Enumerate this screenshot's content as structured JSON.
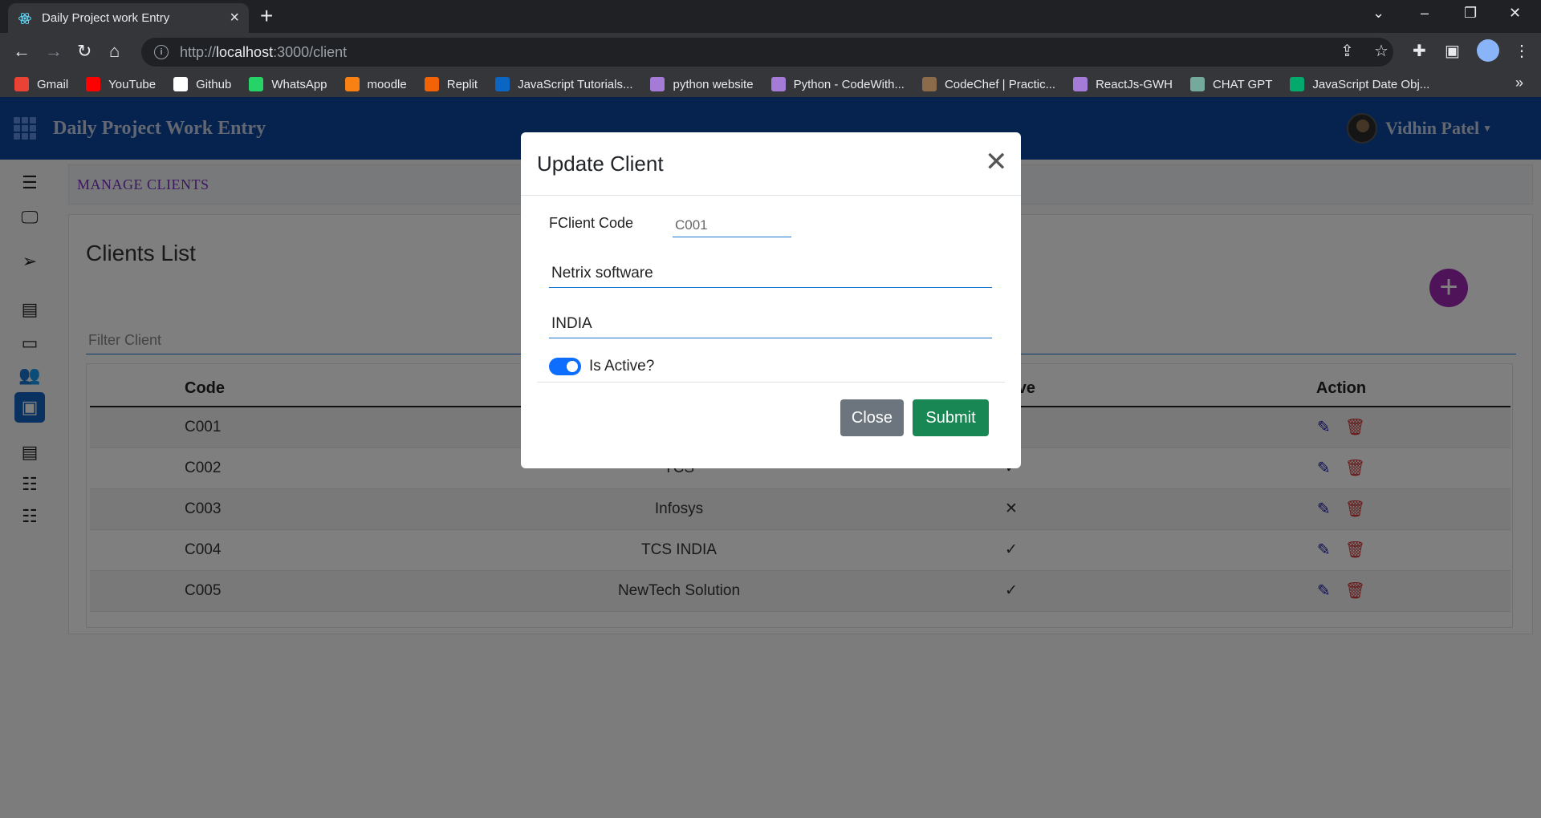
{
  "browser": {
    "tab_title": "Daily Project work Entry",
    "url_prefix": "http://",
    "url_host": "localhost",
    "url_path": ":3000/client",
    "bookmarks": [
      {
        "label": "Gmail",
        "icon": "gmail-icon",
        "color": "#ea4335"
      },
      {
        "label": "YouTube",
        "icon": "youtube-icon",
        "color": "#ff0000"
      },
      {
        "label": "Github",
        "icon": "github-icon",
        "color": "#ffffff"
      },
      {
        "label": "WhatsApp",
        "icon": "whatsapp-icon",
        "color": "#25d366"
      },
      {
        "label": "moodle",
        "icon": "moodle-icon",
        "color": "#f98012"
      },
      {
        "label": "Replit",
        "icon": "replit-icon",
        "color": "#f26207"
      },
      {
        "label": "JavaScript Tutorials...",
        "icon": "linkedin-icon",
        "color": "#0a66c2"
      },
      {
        "label": "python website",
        "icon": "codewithharry-icon",
        "color": "#a47bd6"
      },
      {
        "label": "Python - CodeWith...",
        "icon": "codewithharry-icon",
        "color": "#a47bd6"
      },
      {
        "label": "CodeChef | Practic...",
        "icon": "codechef-icon",
        "color": "#8b6b4a"
      },
      {
        "label": "ReactJs-GWH",
        "icon": "codewithharry-icon",
        "color": "#a47bd6"
      },
      {
        "label": "CHAT GPT",
        "icon": "chatgpt-icon",
        "color": "#74aa9c"
      },
      {
        "label": "JavaScript Date Obj...",
        "icon": "w3schools-icon",
        "color": "#04aa6d"
      }
    ]
  },
  "app": {
    "title": "Daily Project Work Entry",
    "user_name": "Vidhin Patel",
    "breadcrumb": "MANAGE CLIENTS",
    "card_title": "Clients List",
    "filter_placeholder": "Filter Client",
    "table": {
      "headers": {
        "code": "Code",
        "active": "Active",
        "action": "Action"
      },
      "rows": [
        {
          "code": "C001",
          "name": "",
          "active": "✓"
        },
        {
          "code": "C002",
          "name": "TCS",
          "active": "✓"
        },
        {
          "code": "C003",
          "name": "Infosys",
          "active": "✕"
        },
        {
          "code": "C004",
          "name": "TCS INDIA",
          "active": "✓"
        },
        {
          "code": "C005",
          "name": "NewTech Solution",
          "active": "✓"
        }
      ]
    }
  },
  "modal": {
    "title": "Update Client",
    "code_label": "FClient Code",
    "code_value": "C001",
    "name_value": "Netrix software",
    "country_value": "INDIA",
    "active_label": "Is Active?",
    "active": true,
    "close_label": "Close",
    "submit_label": "Submit"
  },
  "colors": {
    "appbar": "#0d47a1",
    "fab": "#9c27b0",
    "submit": "#198754",
    "close": "#6c757d",
    "edit_icon": "#1a1aa6",
    "delete_icon": "#d32f2f"
  }
}
